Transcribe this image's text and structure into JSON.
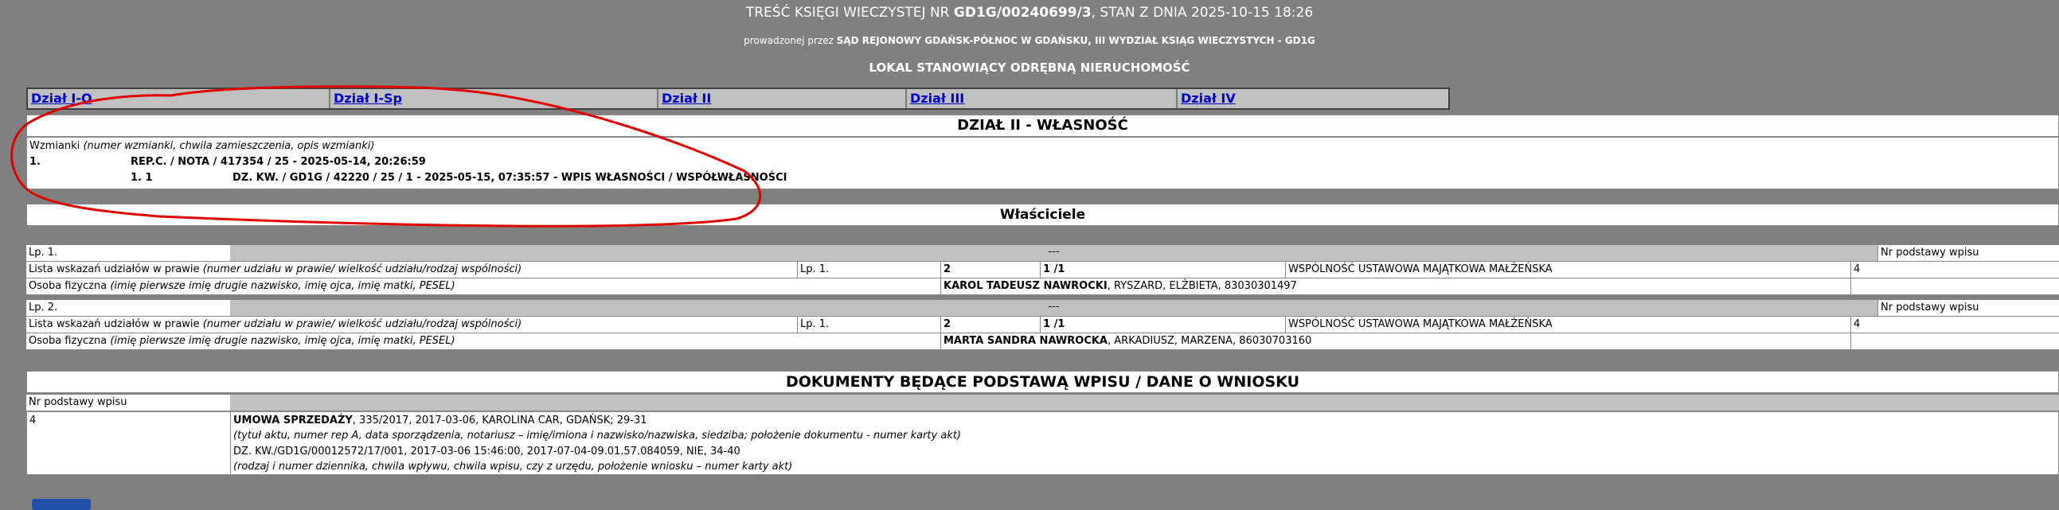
{
  "header": {
    "line1_pre": "TREŚĆ KSIĘGI WIECZYSTEJ NR ",
    "line1_kw": "GD1G/00240699/3",
    "line1_post": ", STAN Z DNIA 2025-10-15 18:26",
    "line2_pre": "prowadzonej przez ",
    "line2_court": "SĄD REJONOWY GDAŃSK-PÓŁNOC W GDAŃSKU, III WYDZIAŁ KSIĄG WIECZYSTYCH - GD1G",
    "line3": "LOKAL STANOWIĄCY ODRĘBNĄ NIERUCHOMOŚĆ"
  },
  "tabs": [
    {
      "label": "Dział I-O"
    },
    {
      "label": "Dział I-Sp"
    },
    {
      "label": "Dział II"
    },
    {
      "label": "Dział III"
    },
    {
      "label": "Dział IV"
    }
  ],
  "section_title": "DZIAŁ II - WŁASNOŚĆ",
  "mentions": {
    "label": "Wzmianki",
    "label_desc": "(numer wzmianki, chwila zamieszczenia, opis wzmianki)",
    "item1_no": "1.",
    "item1_text": "REP.C. / NOTA / 417354 / 25 - 2025-05-14, 20:26:59",
    "item11_no": "1. 1",
    "item11_text": "DZ. KW. / GD1G / 42220 / 25 / 1 - 2025-05-15, 07:35:57 - WPIS WŁASNOŚCI / WSPÓŁWŁASNOŚCI"
  },
  "owners_title": "Właściciele",
  "owners": [
    {
      "lp": "Lp. 1.",
      "bar": "---",
      "nr_label": "Nr podstawy wpisu",
      "share_label": "Lista wskazań udziałów w prawie",
      "share_desc": "(numer udziału w prawie/ wielkość udziału/rodzaj wspólności)",
      "share_lp": "Lp. 1.",
      "share_no": "2",
      "share_size": "1 /1",
      "share_type": "WSPÓLNOŚĆ USTAWOWA MAJĄTKOWA MAŁŻEŃSKA",
      "share_nr": "4",
      "person_label": "Osoba fizyczna",
      "person_desc": "(imię pierwsze imię drugie nazwisko, imię ojca, imię matki, PESEL)",
      "person_name": "KAROL TADEUSZ NAWROCKI",
      "person_rest": ", RYSZARD, ELŻBIETA, 83030301497"
    },
    {
      "lp": "Lp. 2.",
      "bar": "---",
      "nr_label": "Nr podstawy wpisu",
      "share_label": "Lista wskazań udziałów w prawie",
      "share_desc": "(numer udziału w prawie/ wielkość udziału/rodzaj wspólności)",
      "share_lp": "Lp. 1.",
      "share_no": "2",
      "share_size": "1 /1",
      "share_type": "WSPÓLNOŚĆ USTAWOWA MAJĄTKOWA MAŁŻEŃSKA",
      "share_nr": "4",
      "person_label": "Osoba fizyczna",
      "person_desc": "(imię pierwsze imię drugie nazwisko, imię ojca, imię matki, PESEL)",
      "person_name": "MARTA SANDRA NAWROCKA",
      "person_rest": ", ARKADIUSZ, MARZENA, 86030703160"
    }
  ],
  "docs_title": "DOKUMENTY BĘDĄCE PODSTAWĄ WPISU / DANE O WNIOSKU",
  "docs": {
    "nr_label": "Nr podstawy wpisu",
    "nr_value": "4",
    "act_title": "UMOWA SPRZEDAŻY",
    "act_rest": ", 335/2017, 2017-03-06, KAROLINA CAR, GDAŃSK; 29-31",
    "act_desc": "(tytuł aktu, numer rep A, data sporządzenia, notariusz – imię/imiona i nazwisko/nazwiska, siedziba; położenie dokumentu - numer karty akt)",
    "journal": "DZ. KW./GD1G/00012572/17/001, 2017-03-06 15:46:00, 2017-07-04-09.01.57.084059, NIE, 34-40",
    "journal_desc": "(rodzaj i numer dziennika, chwila wpływu, chwila wpisu, czy z urzędu, położenie wniosku – numer karty akt)"
  },
  "colors": {
    "background": "#808080",
    "annotation": "#e00000",
    "link": "#0000cc"
  }
}
